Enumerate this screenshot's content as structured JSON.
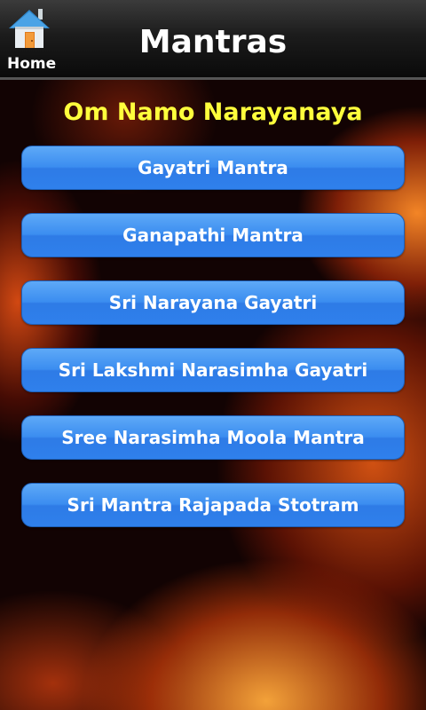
{
  "header": {
    "home_label": "Home",
    "title": "Mantras",
    "home_icon": "home-icon"
  },
  "content": {
    "subtitle": "Om Namo Narayanaya",
    "buttons": [
      {
        "label": "Gayatri Mantra"
      },
      {
        "label": "Ganapathi Mantra"
      },
      {
        "label": "Sri Narayana Gayatri"
      },
      {
        "label": "Sri Lakshmi Narasimha Gayatri"
      },
      {
        "label": "Sree Narasimha Moola Mantra"
      },
      {
        "label": "Sri Mantra Rajapada Stotram"
      }
    ]
  },
  "colors": {
    "subtitle": "#ffff3c",
    "button": "#3b8df0",
    "header": "#1c1c1c"
  }
}
